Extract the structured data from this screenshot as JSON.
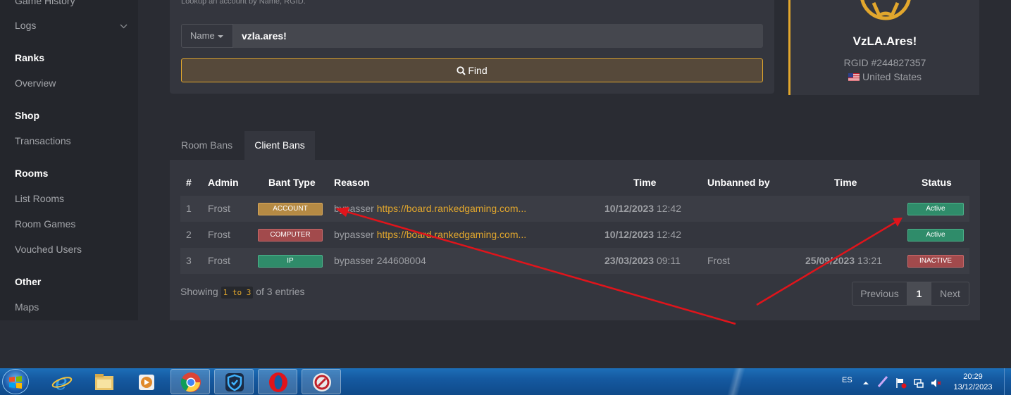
{
  "sidebar": {
    "game_history": "Game History",
    "logs": "Logs",
    "ranks_heading": "Ranks",
    "overview": "Overview",
    "shop_heading": "Shop",
    "transactions": "Transactions",
    "rooms_heading": "Rooms",
    "list_rooms": "List Rooms",
    "room_games": "Room Games",
    "vouched_users": "Vouched Users",
    "other_heading": "Other",
    "maps": "Maps"
  },
  "search": {
    "hint": "Lookup an account by Name, RGID.",
    "type_label": "Name",
    "value": "vzla.ares!",
    "find_label": "Find"
  },
  "profile": {
    "name": "VzLA.Ares!",
    "rgid": "RGID #244827357",
    "country": "United States"
  },
  "tabs": {
    "room_bans": "Room Bans",
    "client_bans": "Client Bans"
  },
  "table": {
    "headers": {
      "num": "#",
      "admin": "Admin",
      "ban_type": "Bant Type",
      "reason": "Reason",
      "time": "Time",
      "unbanned_by": "Unbanned by",
      "time2": "Time",
      "status": "Status"
    },
    "rows": [
      {
        "num": "1",
        "admin": "Frost",
        "ban_type": "ACCOUNT",
        "reason_text": "bypasser",
        "reason_link": "https://board.rankedgaming.com...",
        "time_date": "10/12/2023",
        "time_clock": "12:42",
        "unbanned_by": "",
        "unban_date": "",
        "unban_clock": "",
        "status": "Active"
      },
      {
        "num": "2",
        "admin": "Frost",
        "ban_type": "COMPUTER",
        "reason_text": "bypasser",
        "reason_link": "https://board.rankedgaming.com...",
        "time_date": "10/12/2023",
        "time_clock": "12:42",
        "unbanned_by": "",
        "unban_date": "",
        "unban_clock": "",
        "status": "Active"
      },
      {
        "num": "3",
        "admin": "Frost",
        "ban_type": "IP",
        "reason_text": "bypasser 244608004",
        "reason_link": "",
        "time_date": "23/03/2023",
        "time_clock": "09:11",
        "unbanned_by": "Frost",
        "unban_date": "25/09/2023",
        "unban_clock": "13:21",
        "status": "INACTIVE"
      }
    ]
  },
  "footer": {
    "showing_prefix": "Showing",
    "range": "1 to 3",
    "showing_suffix": "of 3 entries",
    "prev": "Previous",
    "page": "1",
    "next": "Next"
  },
  "taskbar": {
    "lang": "ES",
    "time": "20:29",
    "date": "13/12/2023"
  },
  "colors": {
    "accent": "#e2a72d",
    "active_green": "#2f8c6a",
    "inactive_red": "#a24a4c",
    "arrow_red": "#e0141b"
  }
}
